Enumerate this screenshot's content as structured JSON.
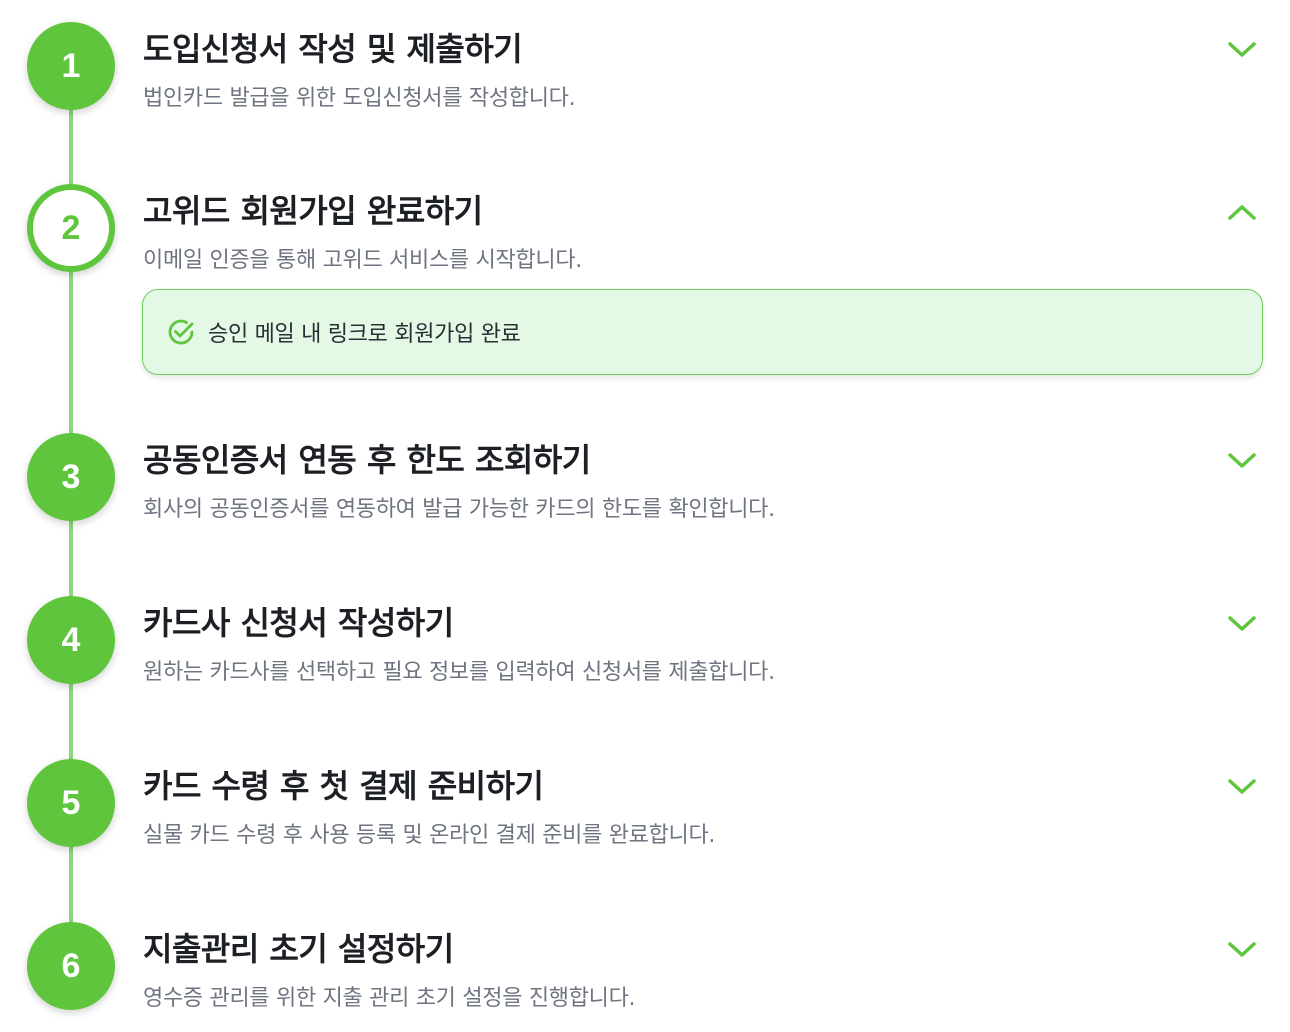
{
  "steps": [
    {
      "number": "1",
      "title": "도입신청서 작성 및 제출하기",
      "desc": "법인카드 발급을 위한 도입신청서를 작성합니다.",
      "expanded": false
    },
    {
      "number": "2",
      "title": "고위드 회원가입 완료하기",
      "desc": "이메일 인증을 통해 고위드 서비스를 시작합니다.",
      "expanded": true
    },
    {
      "number": "3",
      "title": "공동인증서 연동 후 한도 조회하기",
      "desc": "회사의 공동인증서를 연동하여 발급 가능한 카드의 한도를 확인합니다.",
      "expanded": false
    },
    {
      "number": "4",
      "title": "카드사 신청서 작성하기",
      "desc": "원하는 카드사를 선택하고 필요 정보를 입력하여 신청서를 제출합니다.",
      "expanded": false
    },
    {
      "number": "5",
      "title": "카드 수령 후 첫 결제 준비하기",
      "desc": "실물 카드 수령 후 사용 등록 및 온라인 결제 준비를 완료합니다.",
      "expanded": false
    },
    {
      "number": "6",
      "title": "지출관리 초기 설정하기",
      "desc": "영수증 관리를 위한 지출 관리 초기 설정을 진행합니다.",
      "expanded": false
    }
  ],
  "notice": {
    "text": "승인 메일 내 링크로 회원가입 완료",
    "icon": "check-circle-icon"
  },
  "colors": {
    "accent": "#5ec53d",
    "rail": "#8fd77f",
    "notice_bg": "#e4f8e6",
    "notice_border": "#6fd05b"
  }
}
